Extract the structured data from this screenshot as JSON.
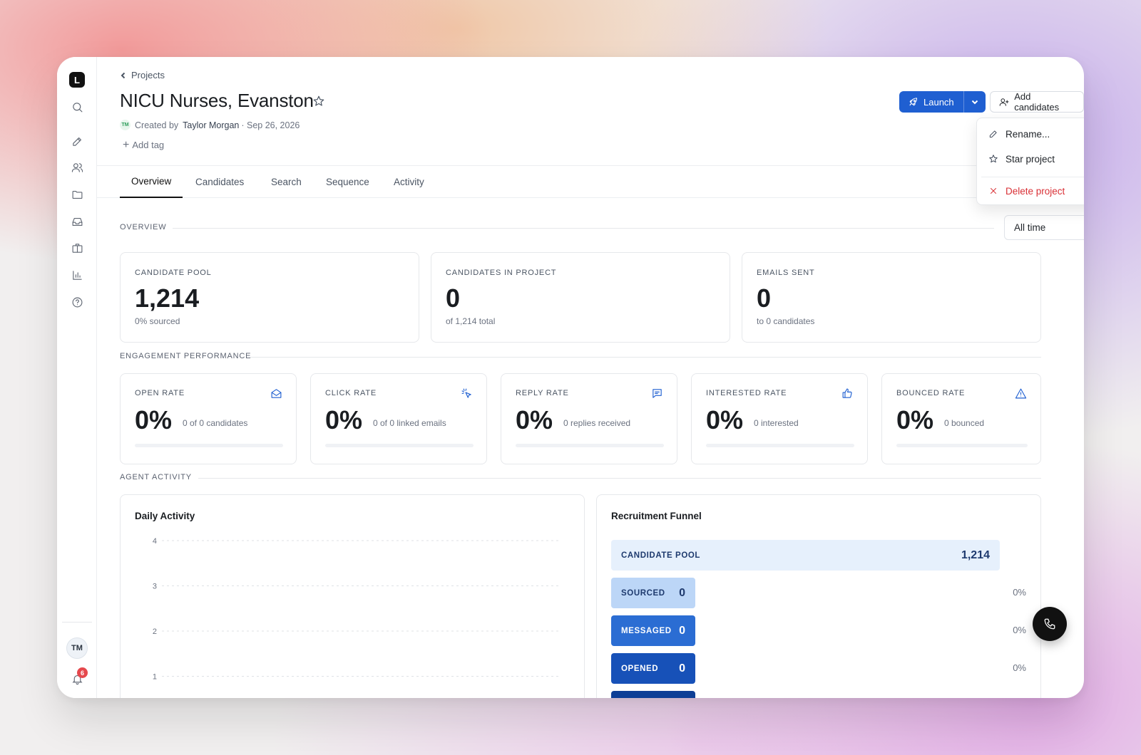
{
  "sidebar": {
    "logo": "L",
    "icons": [
      "search-icon",
      "pencil-icon",
      "users-icon",
      "folder-icon",
      "inbox-icon",
      "briefcase-icon",
      "bar-chart-icon",
      "help-icon"
    ],
    "user_initials": "TM",
    "notification_count": "6"
  },
  "header": {
    "breadcrumb": "Projects",
    "title": "NICU Nurses, Evanston",
    "created_by_prefix": "Created by",
    "creator_initials": "TM",
    "creator_name": "Taylor Morgan",
    "created_date": "· Sep 26, 2026",
    "add_tag": "Add tag",
    "add_tag_icon": "+",
    "launch_label": "Launch",
    "add_candidates_label": "Add candidates",
    "more_label": "···"
  },
  "menu": {
    "rename": "Rename...",
    "star": "Star project",
    "delete": "Delete project"
  },
  "tabs": [
    "Overview",
    "Candidates",
    "Search",
    "Sequence",
    "Activity"
  ],
  "overview": {
    "label": "OVERVIEW",
    "time_filter": "All time",
    "cards": [
      {
        "label": "CANDIDATE POOL",
        "value": "1,214",
        "sub": "0% sourced"
      },
      {
        "label": "CANDIDATES IN PROJECT",
        "value": "0",
        "sub": "of 1,214 total"
      },
      {
        "label": "EMAILS SENT",
        "value": "0",
        "sub": "to 0 candidates"
      }
    ]
  },
  "engagement": {
    "label": "ENGAGEMENT PERFORMANCE",
    "cards": [
      {
        "label": "OPEN RATE",
        "value": "0%",
        "sub": "0 of 0 candidates",
        "icon": "mail-open-icon",
        "progress": 0
      },
      {
        "label": "CLICK RATE",
        "value": "0%",
        "sub": "0 of 0 linked emails",
        "icon": "cursor-click-icon",
        "progress": 0
      },
      {
        "label": "REPLY RATE",
        "value": "0%",
        "sub": "0 replies received",
        "icon": "message-icon",
        "progress": 0
      },
      {
        "label": "INTERESTED RATE",
        "value": "0%",
        "sub": "0 interested",
        "icon": "thumbs-up-icon",
        "progress": 0
      },
      {
        "label": "BOUNCED RATE",
        "value": "0%",
        "sub": "0 bounced",
        "icon": "alert-triangle-icon",
        "progress": 0
      }
    ]
  },
  "agent_activity": {
    "label": "AGENT ACTIVITY",
    "daily_title": "Daily Activity",
    "funnel_title": "Recruitment Funnel"
  },
  "chart_data": {
    "type": "line",
    "title": "Daily Activity",
    "yticks": [
      "4",
      "3",
      "2",
      "1"
    ],
    "ylim": [
      0,
      4
    ],
    "grid": true,
    "series": []
  },
  "funnel": [
    {
      "label": "CANDIDATE POOL",
      "value": "1,214",
      "pct": "",
      "bg": "#e6f0fc",
      "fg": "#1e3a6e"
    },
    {
      "label": "SOURCED",
      "value": "0",
      "pct": "0%",
      "bg": "#bcd6f7",
      "fg": "#1e3a6e"
    },
    {
      "label": "MESSAGED",
      "value": "0",
      "pct": "0%",
      "bg": "#2b6dd3",
      "fg": "#ffffff"
    },
    {
      "label": "OPENED",
      "value": "0",
      "pct": "0%",
      "bg": "#1751b8",
      "fg": "#ffffff"
    },
    {
      "label": "",
      "value": "",
      "pct": "",
      "bg": "#0d3f96",
      "fg": "#ffffff"
    }
  ],
  "colors": {
    "accent": "#1f5fd1",
    "danger": "#d93036"
  }
}
